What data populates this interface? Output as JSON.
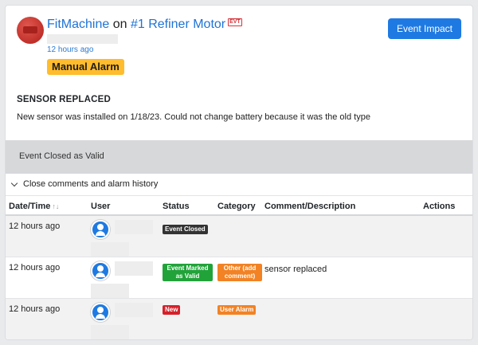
{
  "header": {
    "device_name": "FitMachine",
    "on_text": "on",
    "asset_name": "#1 Refiner Motor",
    "evt_badge": "EVT",
    "time_ago": "12 hours ago",
    "alarm_type": "Manual Alarm",
    "impact_button": "Event Impact"
  },
  "event": {
    "heading": "SENSOR REPLACED",
    "description": "New sensor was installed on 1/18/23. Could not change battery because it was the old type",
    "status_text": "Event Closed as Valid"
  },
  "history": {
    "toggle_label": "Close comments and alarm history",
    "columns": {
      "date": "Date/Time",
      "sort": "↑↓",
      "user": "User",
      "status": "Status",
      "category": "Category",
      "comment": "Comment/Description",
      "actions": "Actions"
    },
    "rows": [
      {
        "date": "12 hours ago",
        "status": "Event Closed",
        "category": "",
        "comment": ""
      },
      {
        "date": "12 hours ago",
        "status": "Event Marked as Valid",
        "category": "Other (add comment)",
        "comment": "sensor replaced"
      },
      {
        "date": "12 hours ago",
        "status": "New",
        "category": "User Alarm",
        "comment": ""
      }
    ]
  },
  "colors": {
    "link": "#1e73d6",
    "primary_button": "#1e7ae2",
    "alarm_badge": "#ffbc2c",
    "status_closed": "#333333",
    "status_valid": "#21a33a",
    "status_new": "#d6202a",
    "category": "#f28224"
  }
}
